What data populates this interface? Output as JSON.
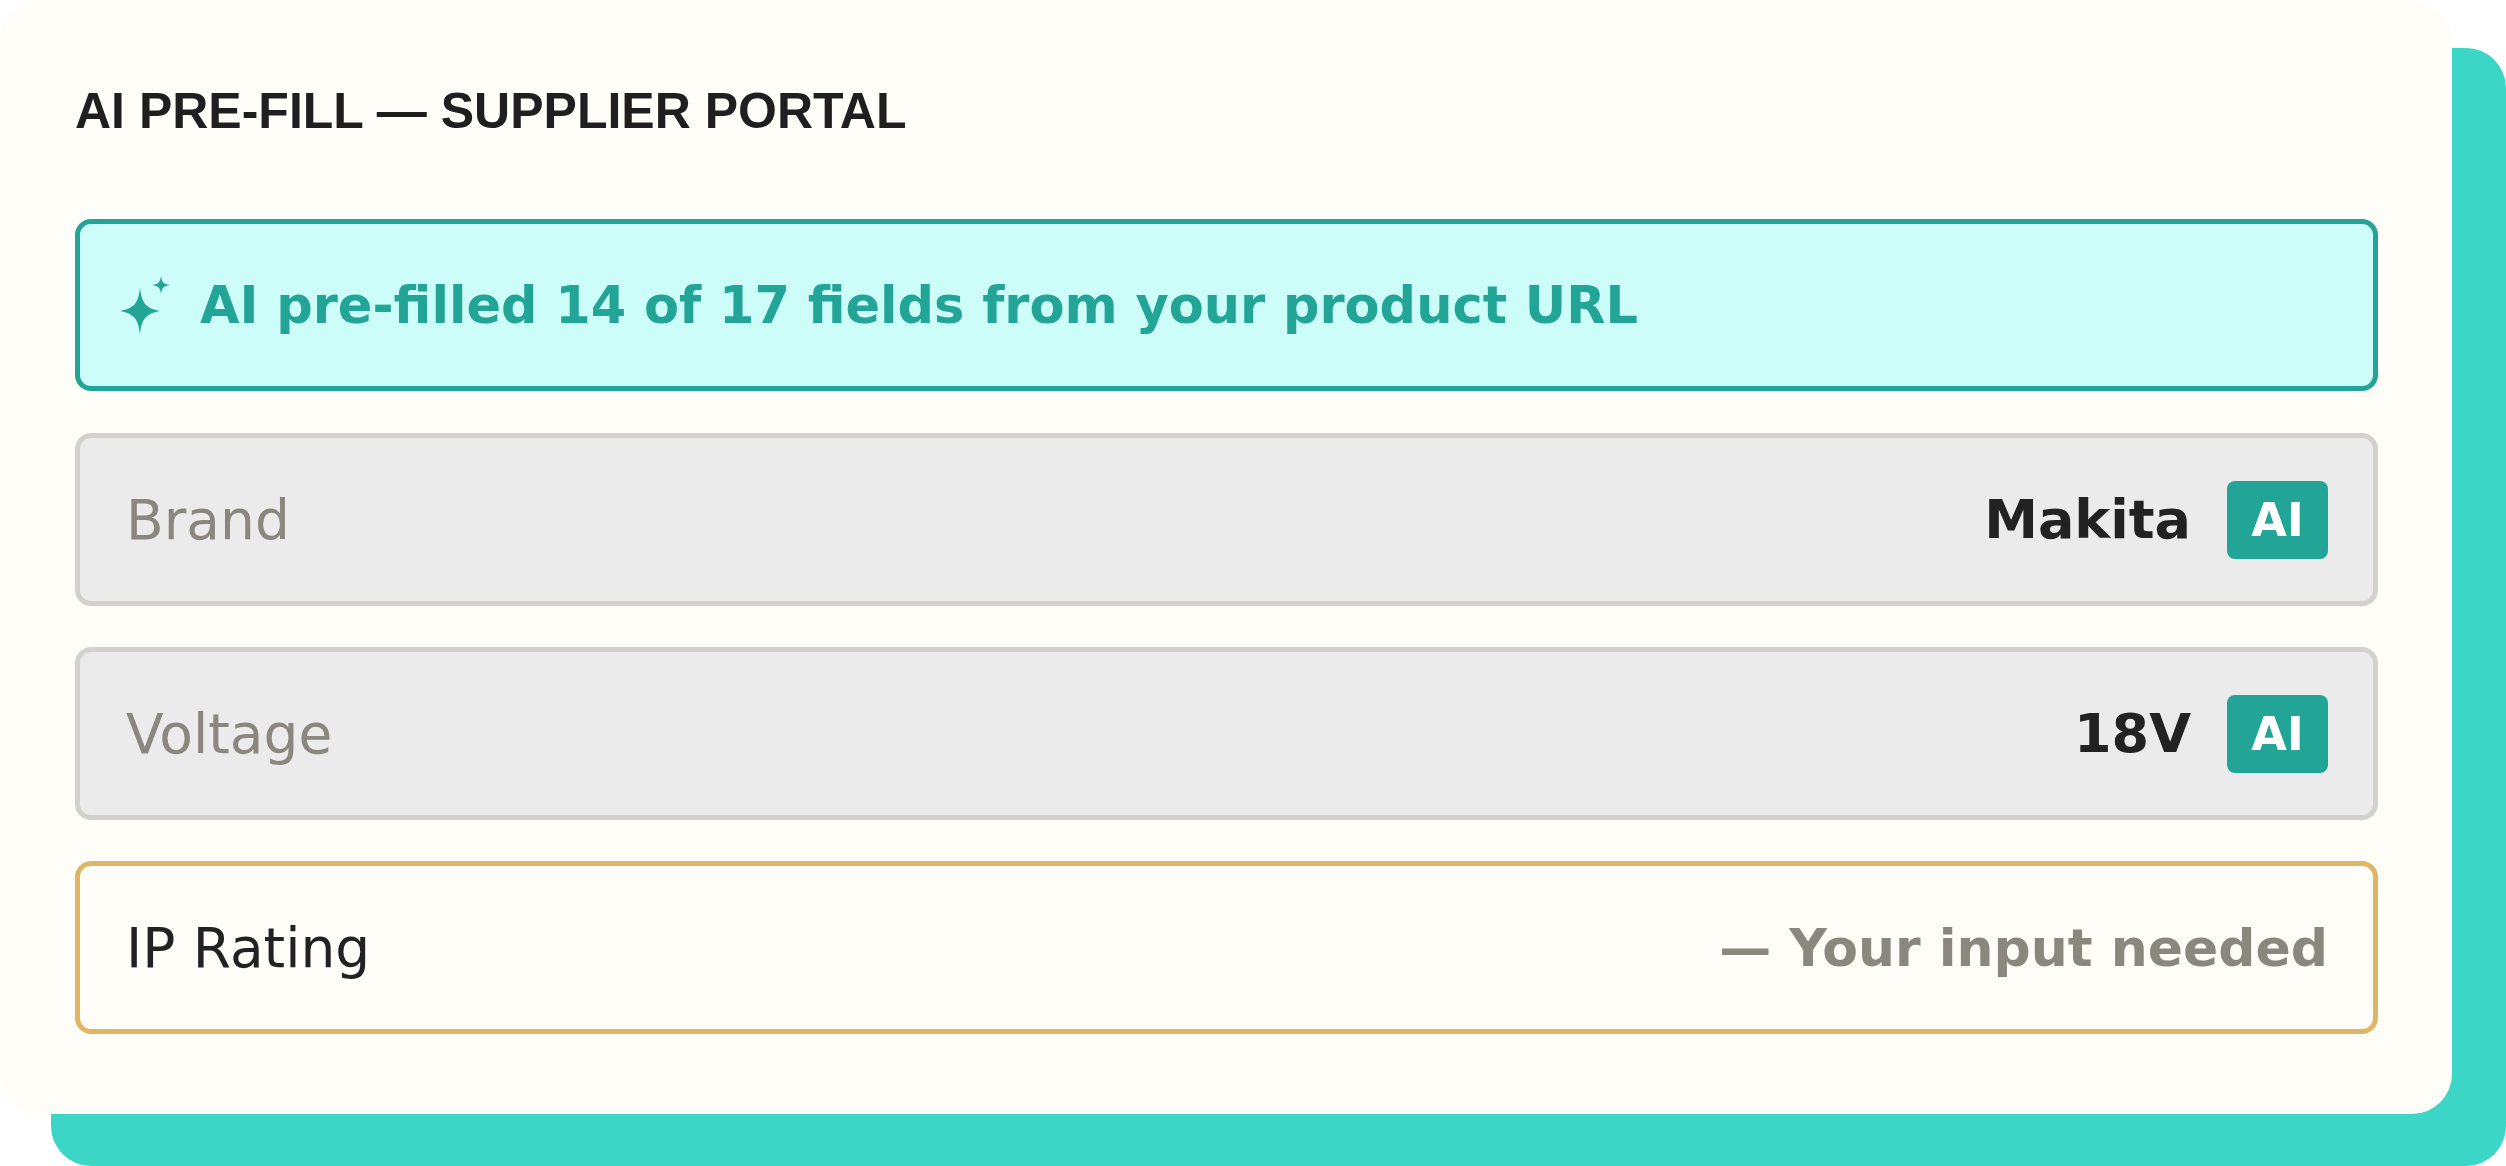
{
  "title": "AI PRE-FILL — SUPPLIER PORTAL",
  "banner": {
    "text": "AI pre-filled 14 of 17 fields from your product URL"
  },
  "fields": [
    {
      "kind": "prefilled",
      "label": "Brand",
      "value": "Makita",
      "badge": "AI"
    },
    {
      "kind": "prefilled",
      "label": "Voltage",
      "value": "18V",
      "badge": "AI"
    },
    {
      "kind": "needed",
      "label": "IP Rating",
      "placeholder": "— Your input needed"
    }
  ]
}
